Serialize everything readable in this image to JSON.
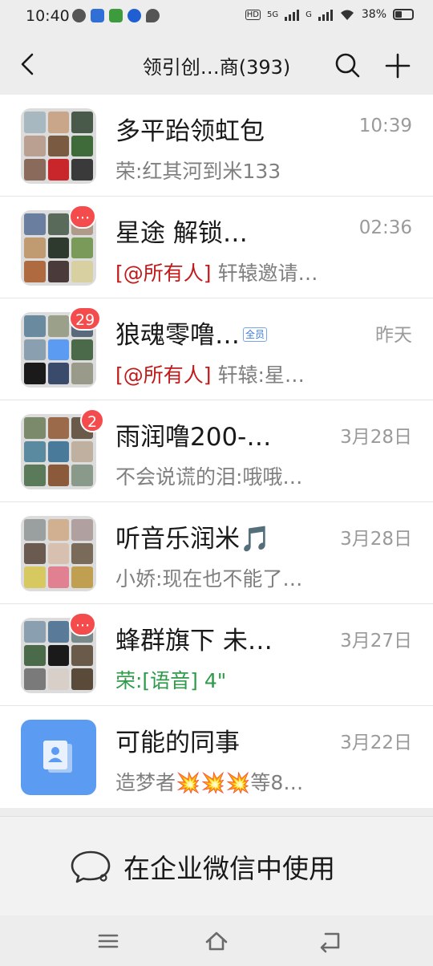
{
  "status": {
    "time": "10:40",
    "hd": "HD",
    "net1": "5G",
    "net2": "G",
    "battery": "38%"
  },
  "header": {
    "title": "领引创…商(393)"
  },
  "chats": [
    {
      "name": "多平跆领虹包",
      "time": "10:39",
      "mention": "",
      "message": "荣:红其河到米133",
      "badge": ""
    },
    {
      "name": "星途 解锁…",
      "time": "02:36",
      "mention": "[@所有人]",
      "message": " 轩辕邀请…",
      "badge": "···"
    },
    {
      "name": "狼魂零噜…",
      "tag": "全员",
      "time": "昨天",
      "mention": "[@所有人]",
      "message": " 轩辕:星…",
      "badge": "29"
    },
    {
      "name": "雨润噜200-…",
      "time": "3月28日",
      "mention": "",
      "message": "不会说谎的泪:哦哦…",
      "badge": "2"
    },
    {
      "name": "听音乐润米🎵",
      "time": "3月28日",
      "mention": "",
      "message": "小娇:现在也不能了…",
      "badge": ""
    },
    {
      "name": "蜂群旗下 未…",
      "time": "3月27日",
      "mention": "",
      "voice": "荣:[语音] 4\"",
      "badge": "···"
    },
    {
      "name": "可能的同事",
      "time": "3月22日",
      "mention": "",
      "message": "造梦者💥💥💥等8…",
      "badge": ""
    }
  ],
  "enterprise": {
    "label": "在企业微信中使用"
  },
  "colors": {
    "background": "#ededed",
    "mention": "#c21a1a",
    "voice": "#2f9b4a",
    "badge": "#f44c4c"
  }
}
